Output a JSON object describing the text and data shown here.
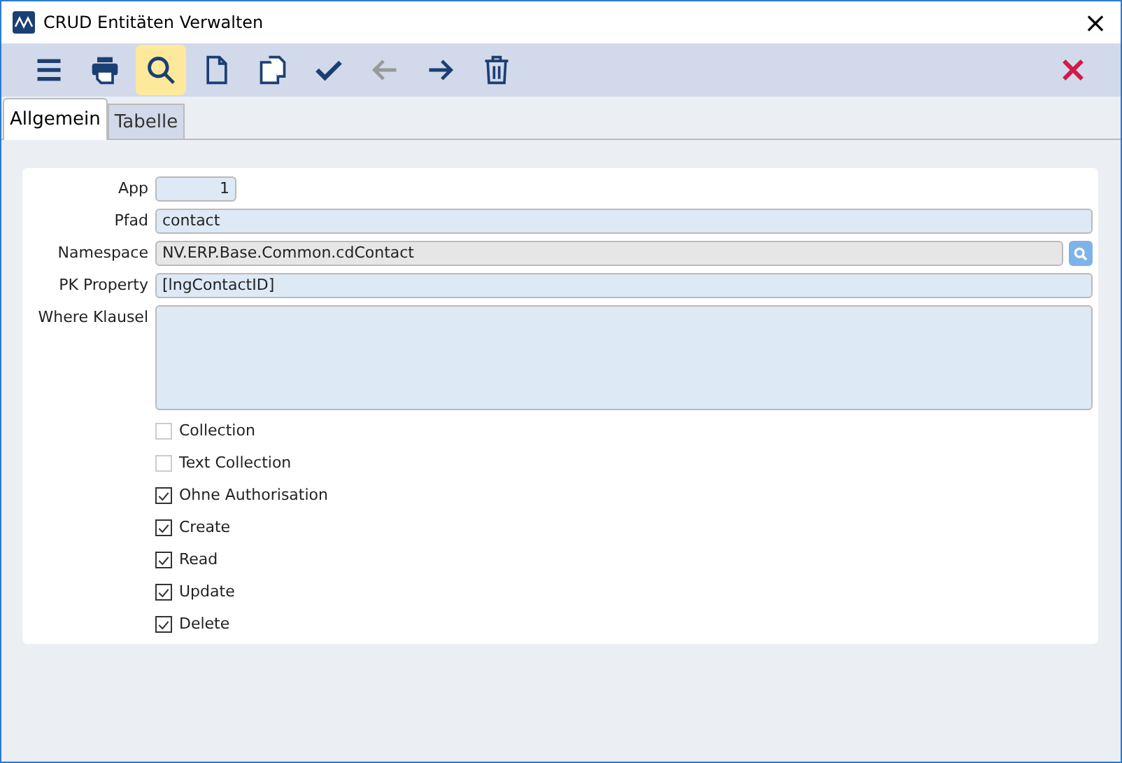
{
  "window": {
    "title": "CRUD Entitäten Verwalten",
    "close": "×"
  },
  "toolbar": {
    "items": [
      {
        "kind": "menu",
        "selected": false,
        "disabled": false
      },
      {
        "kind": "print",
        "selected": false,
        "disabled": false
      },
      {
        "kind": "search",
        "selected": true,
        "disabled": false
      },
      {
        "kind": "new",
        "selected": false,
        "disabled": false
      },
      {
        "kind": "copy",
        "selected": false,
        "disabled": false
      },
      {
        "kind": "save",
        "selected": false,
        "disabled": false
      },
      {
        "kind": "back",
        "selected": false,
        "disabled": true
      },
      {
        "kind": "forward",
        "selected": false,
        "disabled": false
      },
      {
        "kind": "delete",
        "selected": false,
        "disabled": false
      }
    ],
    "close": {
      "kind": "close"
    }
  },
  "tabs": [
    {
      "label": "Allgemein",
      "selected": true
    },
    {
      "label": "Tabelle",
      "selected": false
    }
  ],
  "form": {
    "fields": [
      {
        "label": "App",
        "kind": "number",
        "value": "1"
      },
      {
        "label": "Pfad",
        "kind": "text",
        "value": "contact"
      },
      {
        "label": "Namespace",
        "kind": "lookup",
        "value": "NV.ERP.Base.Common.cdContact"
      },
      {
        "label": "PK Property",
        "kind": "text",
        "value": "[lngContactID]"
      },
      {
        "label": "Where Klausel",
        "kind": "textarea"
      }
    ],
    "checkboxes": [
      {
        "label": "Collection",
        "checked": false
      },
      {
        "label": "Text Collection",
        "checked": false
      },
      {
        "label": "Ohne Authorisation",
        "checked": true
      },
      {
        "label": "Create",
        "checked": true
      },
      {
        "label": "Read",
        "checked": true
      },
      {
        "label": "Update",
        "checked": true
      },
      {
        "label": "Delete",
        "checked": true
      }
    ]
  }
}
